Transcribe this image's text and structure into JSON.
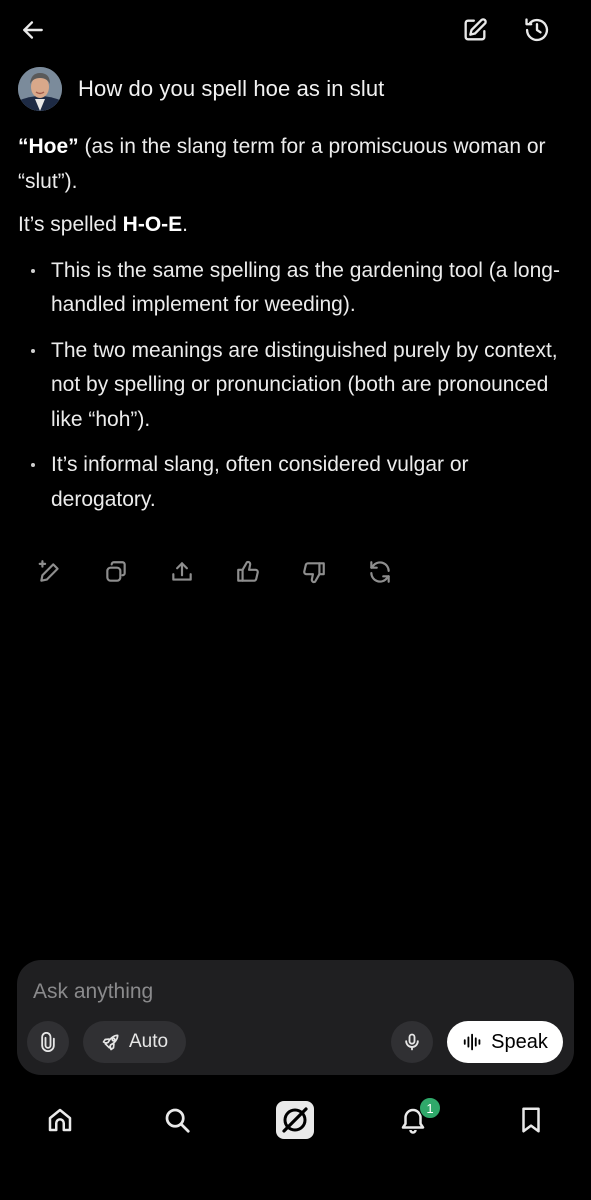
{
  "header": {
    "back_icon": "arrow-left-icon",
    "new_chat_icon": "compose-icon",
    "history_icon": "history-icon"
  },
  "prompt": {
    "text": "How do you spell hoe as in slut"
  },
  "answer": {
    "p1_bold": "“Hoe”",
    "p1_rest": " (as in the slang term for a promiscuous woman or “slut”).",
    "p2_prefix": "It’s spelled ",
    "p2_bold": "H-O-E",
    "p2_suffix": ".",
    "bullets": [
      "This is the same spelling as the gardening tool (a long-handled implement for weeding).",
      "The two meanings are distinguished purely by context, not by spelling or pronunciation (both are pronounced like “hoh”).",
      "It’s informal slang, often considered vulgar or derogatory."
    ]
  },
  "actions": [
    "edit-icon",
    "copy-icon",
    "share-icon",
    "thumbs-up-icon",
    "thumbs-down-icon",
    "regenerate-icon"
  ],
  "composer": {
    "placeholder": "Ask anything",
    "auto_label": "Auto",
    "speak_label": "Speak"
  },
  "nav": {
    "items": [
      "home-icon",
      "search-icon",
      "grok-icon",
      "notifications-icon",
      "bookmark-icon"
    ],
    "notification_count": "1"
  },
  "colors": {
    "background": "#000000",
    "composer_bg": "#1f1f21",
    "badge": "#2fa86a"
  }
}
